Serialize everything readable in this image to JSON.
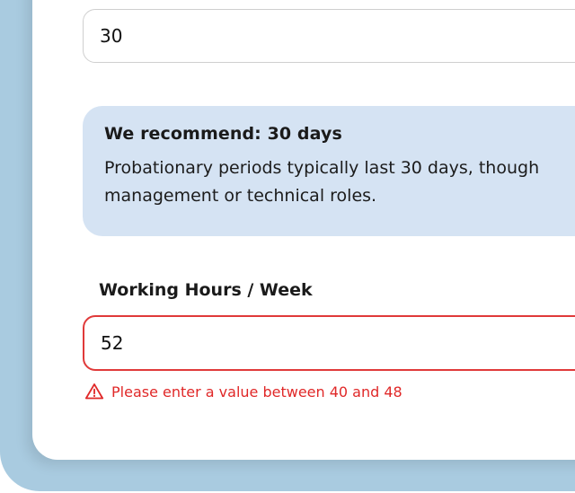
{
  "probation": {
    "value": "30",
    "recommendation": {
      "title": "We recommend: 30 days",
      "body_line1": "Probationary periods typically last 30 days, though",
      "body_line2": "management or technical roles."
    }
  },
  "working_hours": {
    "label": "Working Hours / Week",
    "value": "52",
    "error": "Please enter a value between 40 and 48"
  },
  "colors": {
    "error": "#e02828",
    "info_bg": "#d5e3f3",
    "backdrop": "#a9cbe0"
  },
  "icons": {
    "error_icon": "warning-triangle-icon"
  }
}
